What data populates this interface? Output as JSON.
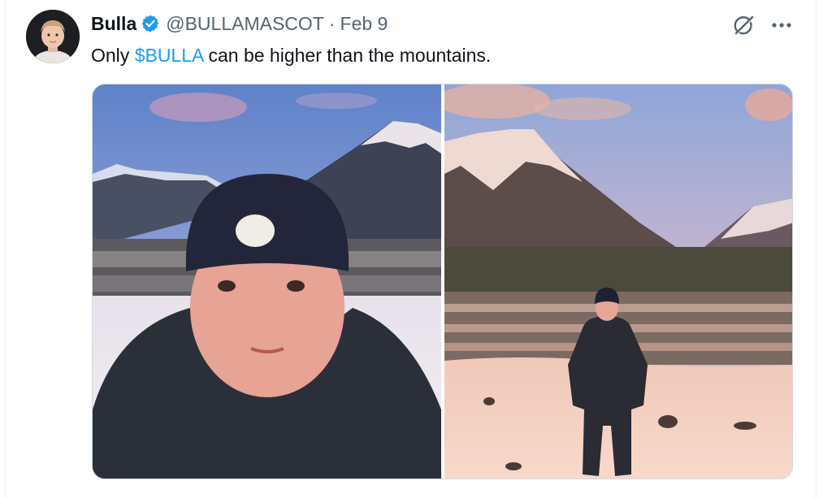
{
  "tweet": {
    "author": {
      "name": "Bulla",
      "handle": "@BULLAMASCOT",
      "verified": true,
      "avatar_icon": "profile-avatar"
    },
    "separator": "·",
    "date": "Feb 9",
    "text": {
      "before": "Only ",
      "cashtag": "$BULLA",
      "after": " can be higher than the mountains."
    },
    "actions": {
      "grok_icon": "grok-icon",
      "more_icon": "more-dots-icon"
    },
    "media": [
      {
        "icon": "photo-selfie-mountains"
      },
      {
        "icon": "photo-standing-in-snow"
      }
    ]
  },
  "colors": {
    "accent": "#1d9bf0",
    "text": "#0f1419",
    "secondary_text": "#536471",
    "border": "#cfd9de"
  }
}
